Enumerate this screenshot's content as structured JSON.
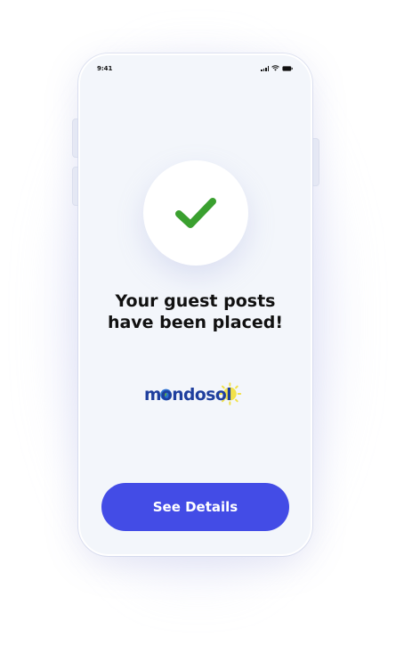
{
  "status_bar": {
    "time": "9:41",
    "icons": [
      "signal-icon",
      "wifi-icon",
      "battery-icon"
    ]
  },
  "success": {
    "icon": "checkmark-icon",
    "check_color": "#3aa02f",
    "headline_line1": "Your guest posts",
    "headline_line2": "have been placed!"
  },
  "brand": {
    "logo_text": "mondosol",
    "logo_color": "#1f3f9e",
    "sun_color": "#f2e24a"
  },
  "actions": {
    "primary_label": "See Details",
    "primary_color": "#434ce6"
  }
}
